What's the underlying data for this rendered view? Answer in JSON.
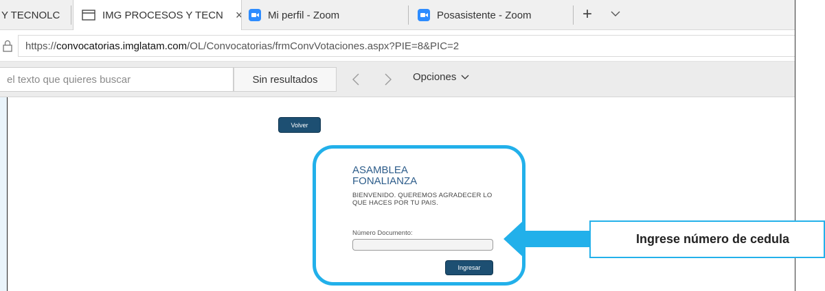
{
  "browser": {
    "tabs": [
      {
        "label": "Y TECNOLC"
      },
      {
        "label": "IMG PROCESOS Y TECN",
        "close": "×",
        "active": true
      },
      {
        "label": "Mi perfil - Zoom",
        "icon": "zoom-icon"
      },
      {
        "label": "Posasistente - Zoom",
        "icon": "zoom-icon"
      }
    ],
    "new_tab": "+",
    "address": {
      "prefix": "https://",
      "domain": "convocatorias.imglatam.com",
      "path": "/OL/Convocatorias/frmConvVotaciones.aspx?PIE=8&PIC=2"
    },
    "find": {
      "placeholder": "el texto que quieres buscar",
      "results": "Sin resultados",
      "options": "Opciones"
    }
  },
  "page": {
    "volver_label": "Volver",
    "card": {
      "title": "ASAMBLEA FONALIANZA",
      "subtitle": "BIENVENIDO. QUEREMOS AGRADECER LO QUE HACES POR TU PAIS.",
      "doc_label": "Número Documento:",
      "doc_value": "",
      "submit_label": "Ingresar"
    }
  },
  "annotation": {
    "callout_text": "Ingrese número de cedula"
  },
  "colors": {
    "accent": "#22b0ea",
    "button": "#1d4f72",
    "title": "#2c5c8a",
    "zoom": "#2d8cff"
  }
}
